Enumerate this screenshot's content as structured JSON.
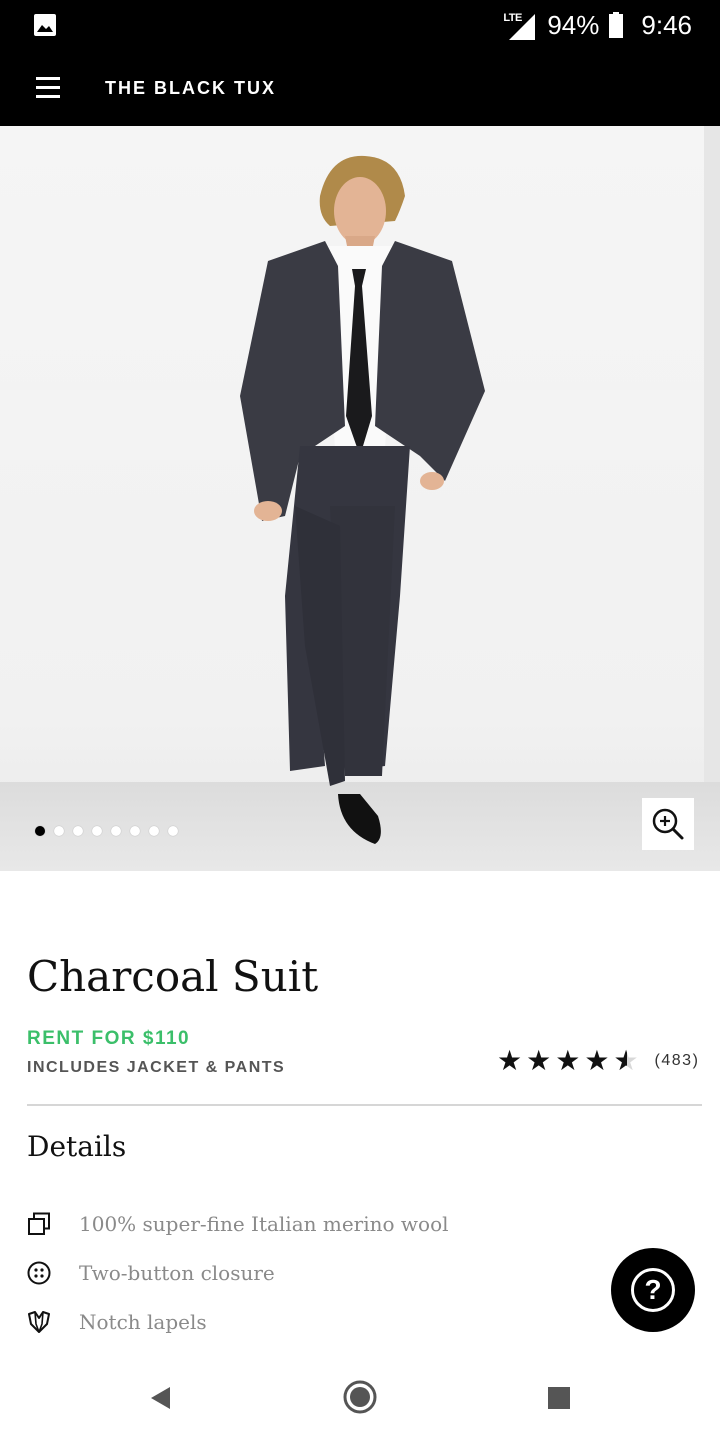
{
  "status_bar": {
    "network": "LTE",
    "battery": "94%",
    "time": "9:46"
  },
  "header": {
    "brand": "THE BLACK TUX",
    "menu_icon": "hamburger-icon"
  },
  "gallery": {
    "image_count": 8,
    "active_index": 0,
    "zoom_icon": "zoom-in-icon"
  },
  "product": {
    "title": "Charcoal Suit",
    "price_label": "RENT FOR $110",
    "includes_label": "INCLUDES JACKET & PANTS",
    "rating": 4.5,
    "review_count": "(483)"
  },
  "details": {
    "heading": "Details",
    "items": [
      {
        "icon": "fabric-swatch-icon",
        "text": "100% super-fine Italian merino wool"
      },
      {
        "icon": "button-icon",
        "text": "Two-button closure"
      },
      {
        "icon": "lapel-icon",
        "text": "Notch lapels"
      }
    ]
  },
  "help_button": {
    "icon": "help-icon",
    "label": "?"
  },
  "nav_bar": {
    "back_icon": "back-icon",
    "home_icon": "home-icon",
    "recents_icon": "recents-icon"
  },
  "colors": {
    "price_green": "#3bbf6a",
    "header_bg": "#000000",
    "detail_text": "#8a8a8a"
  }
}
